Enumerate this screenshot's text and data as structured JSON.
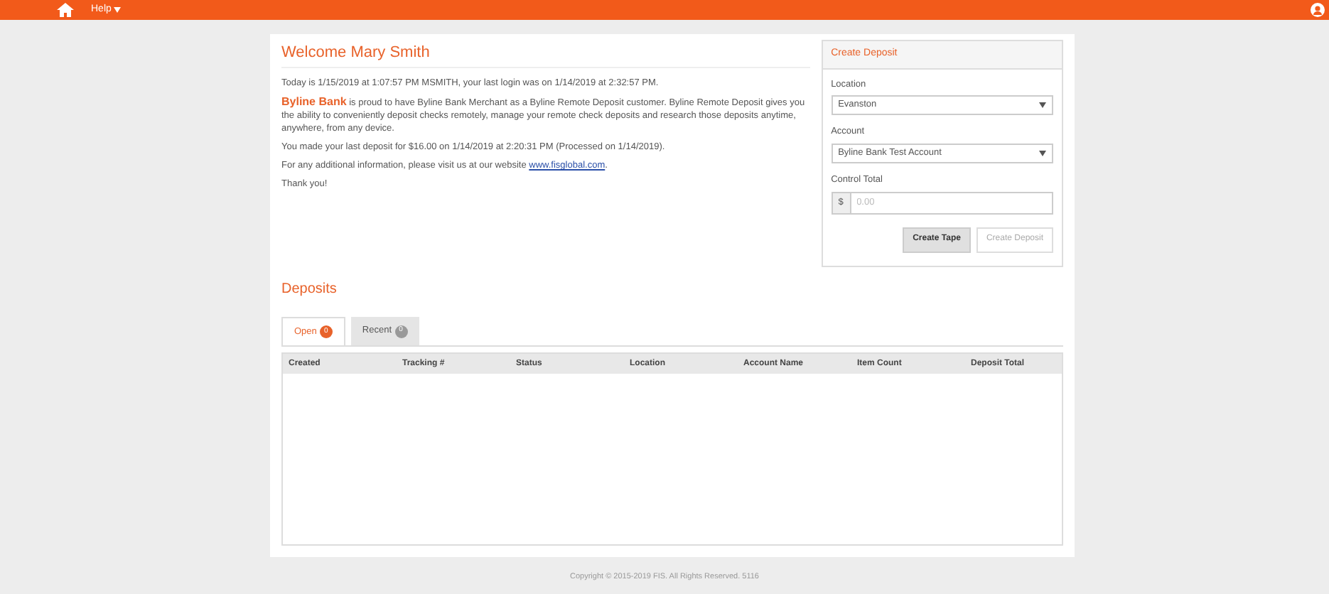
{
  "navbar": {
    "menu": "Help"
  },
  "welcome": {
    "title": "Welcome Mary Smith",
    "today": "Today is 1/15/2019 at 1:07:57 PM MSMITH, your last login was on 1/14/2019 at 2:32:57 PM.",
    "bank_name": "Byline Bank",
    "intro": "is proud to have Byline Bank Merchant as a Byline Remote Deposit customer. Byline Remote Deposit gives you the ability to conveniently deposit checks remotely, manage your remote check deposits and research those deposits anytime, anywhere, from any device.",
    "last_deposit": "You made your last deposit for $16.00 on 1/14/2019 at 2:20:31 PM (Processed on 1/14/2019).",
    "info": "For any additional information, please visit us at our website",
    "link": "www.fisglobal.com",
    "info_end": ".",
    "thanks": "Thank you!"
  },
  "create_deposit": {
    "title": "Create Deposit",
    "location_label": "Location",
    "location": "Evanston",
    "account_label": "Account",
    "account": "Byline Bank Test Account",
    "total_label": "Control Total",
    "currency": "$",
    "total_placeholder": "0.00",
    "buttons": [
      {
        "label": "Create Tape",
        "disabled": false
      },
      {
        "label": "Create Deposit",
        "disabled": true
      }
    ]
  },
  "deposits": {
    "title": "Deposits",
    "tabs": [
      {
        "label": "Open",
        "count": "0",
        "selected": true
      },
      {
        "label": "Recent",
        "count": "0",
        "selected": false
      }
    ],
    "columns": [
      "Created",
      "Tracking #",
      "Status",
      "Location",
      "Account Name",
      "Item Count",
      "Deposit Total"
    ]
  },
  "footer": "Copyright © 2015-2019 FIS. All Rights Reserved. 5116"
}
